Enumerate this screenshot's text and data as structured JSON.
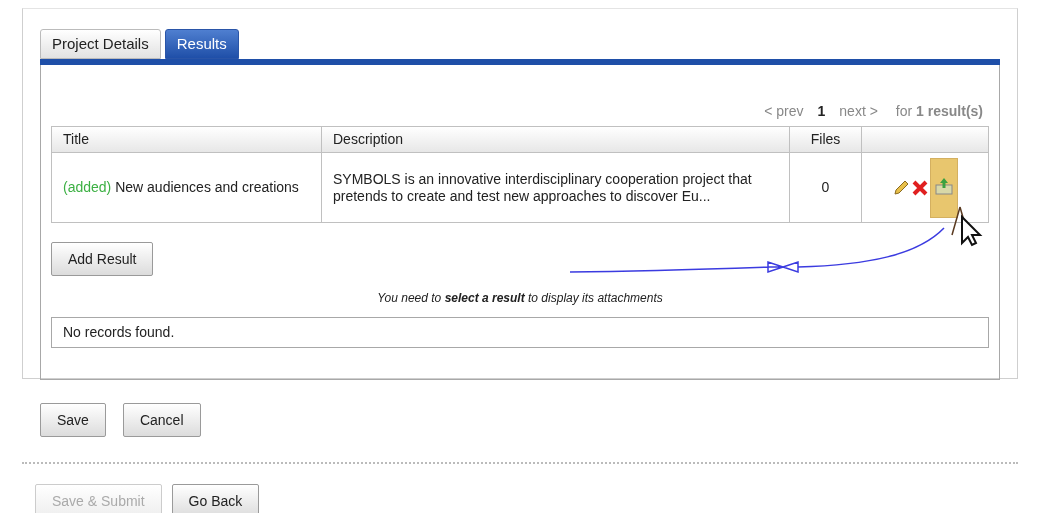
{
  "tabs": [
    {
      "label": "Project Details",
      "selected": false
    },
    {
      "label": "Results",
      "selected": true
    }
  ],
  "pagination": {
    "prev": "< prev",
    "pages": [
      {
        "label": "1",
        "selected": true
      }
    ],
    "next": "next >",
    "summary": "for **1 result(s)**"
  },
  "results_table": {
    "columns": [
      "Title",
      "Description",
      "Files"
    ],
    "rows": [
      {
        "status": "(added)",
        "title": "New audiences and creations",
        "description": "SYMBOLS is an innovative interdisciplinary cooperation project that pretends to create and test new approaches to discover Eu...",
        "files": "0"
      }
    ]
  },
  "add_button": "Add Result",
  "attachments_hint": "You need to **select a result** to display its attachments",
  "attachments_empty": "No records found.",
  "form_buttons": [
    {
      "label": "Save"
    },
    {
      "label": "Cancel"
    }
  ],
  "bottom_buttons": [
    {
      "label": "Save & Submit",
      "disabled": true
    },
    {
      "label": "Go Back",
      "disabled": false
    }
  ]
}
